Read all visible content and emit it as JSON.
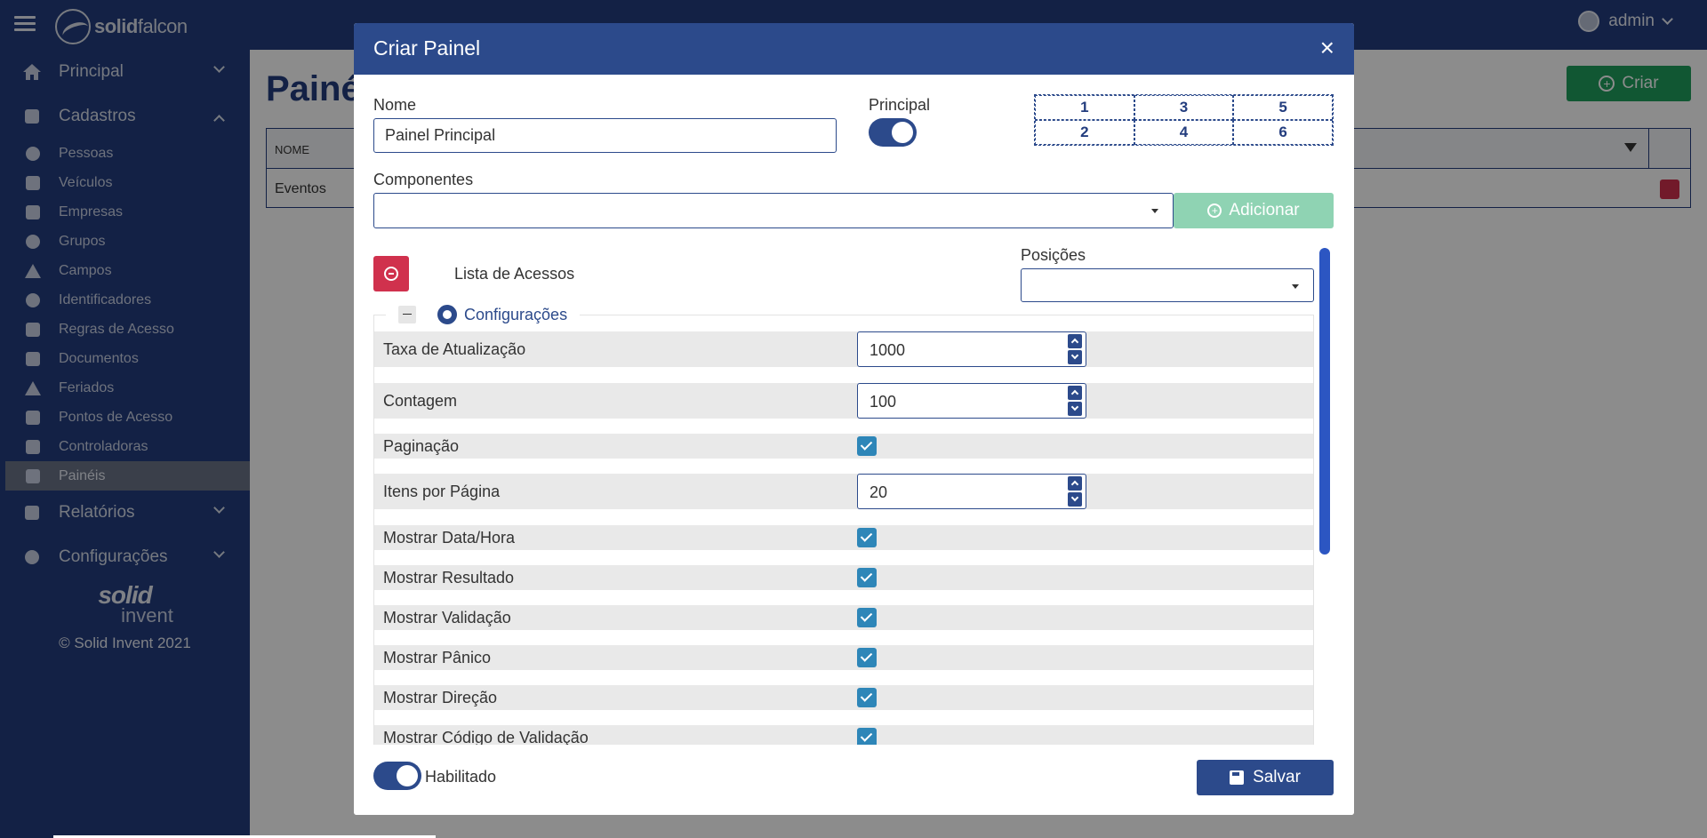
{
  "topbar": {
    "brand_bold": "solid",
    "brand_rest": "falcon",
    "user": "admin"
  },
  "sidebar": {
    "principal": "Principal",
    "cadastros": "Cadastros",
    "items": [
      {
        "label": "Pessoas",
        "icon": "people-icon"
      },
      {
        "label": "Veículos",
        "icon": "truck-icon"
      },
      {
        "label": "Empresas",
        "icon": "building-icon"
      },
      {
        "label": "Grupos",
        "icon": "group-icon"
      },
      {
        "label": "Campos",
        "icon": "shapes-icon"
      },
      {
        "label": "Identificadores",
        "icon": "fingerprint-icon"
      },
      {
        "label": "Regras de Acesso",
        "icon": "gavel-icon"
      },
      {
        "label": "Documentos",
        "icon": "id-card-icon"
      },
      {
        "label": "Feriados",
        "icon": "plane-icon"
      },
      {
        "label": "Pontos de Acesso",
        "icon": "door-icon"
      },
      {
        "label": "Controladoras",
        "icon": "chip-icon"
      },
      {
        "label": "Painéis",
        "icon": "dashboard-icon"
      }
    ],
    "active_item": "Painéis",
    "relatorios": "Relatórios",
    "configuracoes": "Configurações",
    "footer_logo_top": "solid",
    "footer_logo_bottom": "invent",
    "copyright": "© Solid Invent 2021"
  },
  "main": {
    "title": "Painé",
    "create_button": "Criar",
    "table": {
      "header_nome": "NOME",
      "rows": [
        "Eventos"
      ]
    }
  },
  "modal": {
    "title": "Criar Painel",
    "close": "×",
    "nome_label": "Nome",
    "nome_value": "Painel Principal",
    "principal_label": "Principal",
    "principal_on": true,
    "positions_grid": [
      "1",
      "3",
      "5",
      "2",
      "4",
      "6"
    ],
    "componentes_label": "Componentes",
    "componentes_value": "",
    "add_button": "Adicionar",
    "component_name": "Lista de Acessos",
    "posicoes_label": "Posições",
    "posicoes_value": "",
    "config_legend": "Configurações",
    "settings": [
      {
        "label": "Taxa de Atualização",
        "type": "number",
        "value": "1000"
      },
      {
        "label": "Contagem",
        "type": "number",
        "value": "100"
      },
      {
        "label": "Paginação",
        "type": "checkbox",
        "checked": true
      },
      {
        "label": "Itens por Página",
        "type": "number",
        "value": "20"
      },
      {
        "label": "Mostrar Data/Hora",
        "type": "checkbox",
        "checked": true
      },
      {
        "label": "Mostrar Resultado",
        "type": "checkbox",
        "checked": true
      },
      {
        "label": "Mostrar Validação",
        "type": "checkbox",
        "checked": true
      },
      {
        "label": "Mostrar Pânico",
        "type": "checkbox",
        "checked": true
      },
      {
        "label": "Mostrar Direção",
        "type": "checkbox",
        "checked": true
      },
      {
        "label": "Mostrar Código de Validação",
        "type": "checkbox",
        "checked": true
      }
    ],
    "habilitado_label": "Habilitado",
    "habilitado_on": true,
    "save_button": "Salvar"
  },
  "colors": {
    "navy": "#233d7e",
    "header_blue": "#2c4a8b",
    "green": "#1f9e5e",
    "danger": "#d0314d",
    "checkbox": "#2e86b8"
  }
}
